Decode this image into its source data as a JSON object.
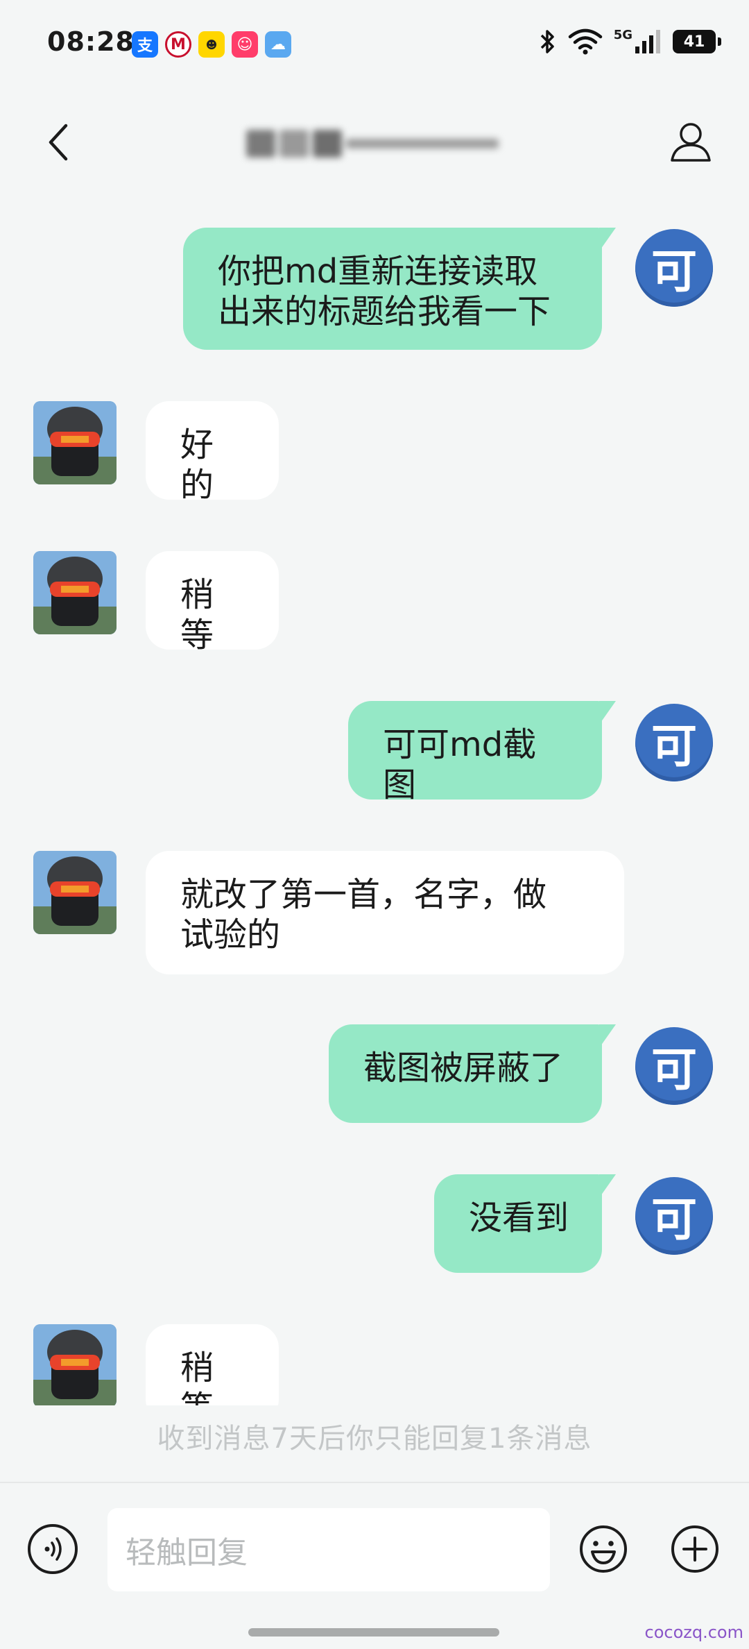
{
  "status_bar": {
    "time": "08:28",
    "network": "5G",
    "battery": "41",
    "notification_icons": [
      "alipay-icon",
      "bank-app-icon",
      "yellow-app-icon",
      "red-app-icon",
      "weather-icon"
    ]
  },
  "header": {
    "title": "",
    "back_icon": "chevron-left-icon",
    "profile_icon": "person-icon"
  },
  "self_avatar_char": "可",
  "messages": [
    {
      "sender": "self",
      "text": "你把md重新连接读取\n出来的标题给我看一下"
    },
    {
      "sender": "other",
      "text": "好的"
    },
    {
      "sender": "other",
      "text": "稍等"
    },
    {
      "sender": "self",
      "text": "可可md截图"
    },
    {
      "sender": "other",
      "text": "就改了第一首，名字，做\n试验的"
    },
    {
      "sender": "self",
      "text": "截图被屏蔽了"
    },
    {
      "sender": "self",
      "text": "没看到"
    },
    {
      "sender": "other",
      "text": "稍等"
    }
  ],
  "notice": "收到消息7天后你只能回复1条消息",
  "input_bar": {
    "placeholder": "轻触回复",
    "voice_icon": "voice-icon",
    "emoji_icon": "emoji-icon",
    "plus_icon": "plus-icon"
  },
  "watermark": "cocozq.com",
  "colors": {
    "self_bubble": "#95e8c6",
    "other_bubble": "#ffffff",
    "self_avatar": "#3a6fc0",
    "background": "#f4f6f6"
  }
}
